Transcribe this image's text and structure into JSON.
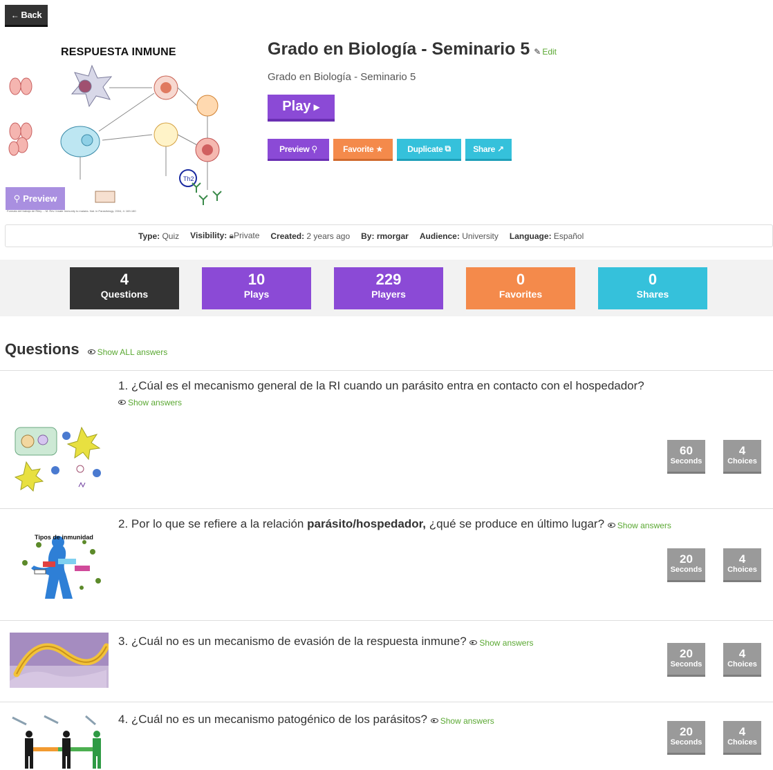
{
  "nav": {
    "back_label": "Back"
  },
  "cover": {
    "title": "RESPUESTA INMUNE",
    "preview_label": "Preview",
    "caption": "Formato del trabajo de Riley ... M. Rev. Innate Immunity to malaria. Nat. in Parasitology. 2004, 4: 169-180"
  },
  "quiz": {
    "title": "Grado en Biología - Seminario 5",
    "edit_label": "Edit",
    "subtitle": "Grado en Biología - Seminario 5",
    "play_label": "Play"
  },
  "actions": {
    "preview": "Preview",
    "favorite": "Favorite",
    "duplicate": "Duplicate",
    "share": "Share"
  },
  "meta": {
    "type_label": "Type:",
    "type": "Quiz",
    "visibility_label": "Visibility:",
    "visibility": "Private",
    "created_label": "Created:",
    "created": "2 years ago",
    "by_label": "By:",
    "by": "rmorgar",
    "audience_label": "Audience:",
    "audience": "University",
    "language_label": "Language:",
    "language": "Español"
  },
  "stats": {
    "questions": {
      "value": "4",
      "label": "Questions"
    },
    "plays": {
      "value": "10",
      "label": "Plays"
    },
    "players": {
      "value": "229",
      "label": "Players"
    },
    "favorites": {
      "value": "0",
      "label": "Favorites"
    },
    "shares": {
      "value": "0",
      "label": "Shares"
    }
  },
  "questions_section": {
    "heading": "Questions",
    "show_all_label": "Show ALL answers",
    "show_answers_label": "Show answers",
    "seconds_label": "Seconds",
    "choices_label": "Choices",
    "items": [
      {
        "text": "1. ¿Cúal es el mecanismo general de la RI cuando un parásito entra en contacto con el hospedador?",
        "seconds": "60",
        "choices": "4"
      },
      {
        "text_before": "2. Por lo que se refiere a la relación ",
        "text_bold": "parásito/hospedador,",
        "text_after": " ¿qué se produce en último lugar?",
        "seconds": "20",
        "choices": "4",
        "image_title": "Tipos de inmunidad"
      },
      {
        "text": "3. ¿Cuál no es un mecanismo de evasión de la respuesta inmune?",
        "seconds": "20",
        "choices": "4"
      },
      {
        "text": "4. ¿Cuál no es un mecanismo patogénico de los parásitos?",
        "seconds": "20",
        "choices": "4"
      }
    ]
  },
  "colors": {
    "purple": "#8b4ad6",
    "orange": "#f48a4b",
    "cyan": "#35c1db",
    "dark": "#333333",
    "green_link": "#5aa832",
    "badge_gray": "#9a9a9a"
  }
}
